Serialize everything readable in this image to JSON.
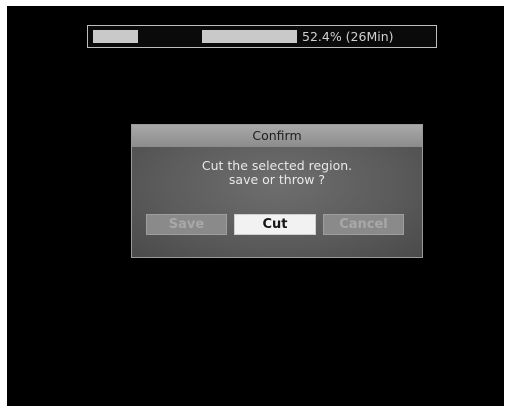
{
  "progress": {
    "percent": 52.4,
    "label": "52.4% (26Min)"
  },
  "dialog": {
    "title": "Confirm",
    "message_line1": "Cut the selected region.",
    "message_line2": "save or throw ?",
    "buttons": {
      "save": "Save",
      "cut": "Cut",
      "cancel": "Cancel"
    },
    "selected_button": "Cut"
  },
  "colors": {
    "screen_background": "#000000",
    "dialog_background": "#5c5c5c",
    "titlebar": "#9a9a9a",
    "selected_button": "#f2f2f2",
    "unselected_button": "#8a8a8a"
  }
}
